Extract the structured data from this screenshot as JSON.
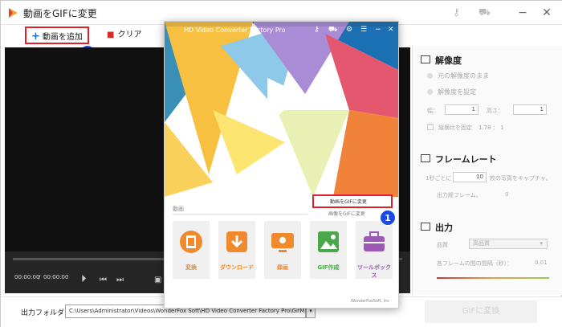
{
  "window": {
    "title": "動画をGIFに変更",
    "colors": {
      "accent": "#1c6fd1",
      "highlight": "#e0212b",
      "badge": "#1a49e6"
    }
  },
  "toolbar": {
    "add_label": "動画を追加",
    "clear_label": "クリア"
  },
  "player": {
    "current_time": "00:00:00",
    "total_time": "00:00:00"
  },
  "settings": {
    "resolution": {
      "title": "解像度",
      "keep_label": "元の解像度のまま",
      "set_label": "解像度を設定",
      "width_label": "幅：",
      "width_value": "1",
      "height_label": "高さ：",
      "height_value": "1",
      "aspect_label": "縦横比を固定",
      "aspect_value": "1.78 ： 1"
    },
    "framerate": {
      "title": "フレームレート",
      "per_second_label": "1秒ごとに",
      "per_second_value": "10",
      "capture_suffix": "枚の写真をキャプチャ。",
      "output_frames_label": "出力総フレーム。",
      "output_frames_value": "0"
    },
    "output": {
      "title": "出力",
      "quality_label": "品質",
      "quality_value": "高品質",
      "interval_label": "各フレームの間の間隔（秒）：",
      "interval_value": "0.01"
    }
  },
  "bottom": {
    "output_folder_label": "出力フォルダ：",
    "output_path": "C:\\Users\\Administrator\\Videos\\WonderFox Soft\\HD Video Converter Factory Pro\\GifMaker\\",
    "convert_label": "GIFに変換"
  },
  "popup": {
    "title": "HD Video Converter Factory Pro",
    "section_label": "動画",
    "menu_items": [
      "動画をGIFに変更",
      "画像をGIFに変更"
    ],
    "tiles": [
      {
        "label": "変換",
        "color": "#f08a2c"
      },
      {
        "label": "ダウンロード",
        "color": "#f08a2c"
      },
      {
        "label": "録画",
        "color": "#f08a2c"
      },
      {
        "label": "GIF作成",
        "color": "#4aa84a"
      },
      {
        "label": "ツールボックス",
        "color": "#9b5bb5"
      }
    ],
    "brand": "WonderFoxSoft, Inc"
  },
  "annotations": {
    "step1": "1",
    "step2": "2"
  }
}
